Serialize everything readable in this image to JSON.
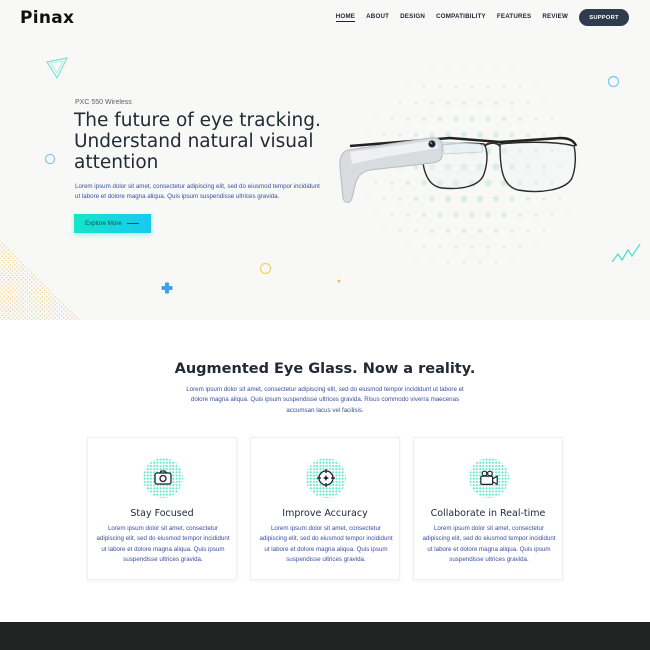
{
  "header": {
    "logo": "Pinax",
    "nav": [
      "HOME",
      "ABOUT",
      "DESIGN",
      "COMPATIBILITY",
      "FEATURES",
      "REVIEW"
    ],
    "active_nav": "HOME",
    "support_label": "SUPPORT"
  },
  "hero": {
    "subtitle": "PXC 550 Wireless",
    "title": "The future of eye tracking. Understand natural visual attention",
    "text": "Lorem ipsum dolor sit amet, consectetur adipiscing elit, sed do eiusmod tempor incididunt ut labore et dolore magna aliqua. Quis ipsum suspendisse ultrices gravida.",
    "button_label": "Explore More",
    "image": "smart-glasses"
  },
  "section": {
    "title": "Augmented Eye Glass. Now a reality.",
    "text": "Lorem ipsum dolor sit amet, consectetur adipiscing elit, sed do eiusmod tempor incididunt ut labore et dolore magna aliqua. Quis ipsum suspendisse ultrices gravida. Risus commodo viverra maecenas accumsan lacus vel facilisis."
  },
  "features": [
    {
      "icon": "camera-icon",
      "title": "Stay Focused",
      "text": "Lorem ipsum dolor sit amet, consectetur adipiscing elit, sed do eiusmod tempor incididunt ut labore et dolore magna aliqua. Quis ipsum suspendisse ultrices gravida."
    },
    {
      "icon": "target-icon",
      "title": "Improve Accuracy",
      "text": "Lorem ipsum dolor sit amet, consectetur adipiscing elit, sed do eiusmod tempor incididunt ut labore et dolore magna aliqua. Quis ipsum suspendisse ultrices gravida."
    },
    {
      "icon": "video-camera-icon",
      "title": "Collaborate in Real-time",
      "text": "Lorem ipsum dolor sit amet, consectetur adipiscing elit, sed do eiusmod tempor incididunt ut labore et dolore magna aliqua. Quis ipsum suspendisse ultrices gravida."
    }
  ],
  "colors": {
    "accent": "#14e6c8",
    "support_bg": "#2f3c4e",
    "footer_bg": "#222323",
    "text_blue": "#3a4ea0"
  }
}
